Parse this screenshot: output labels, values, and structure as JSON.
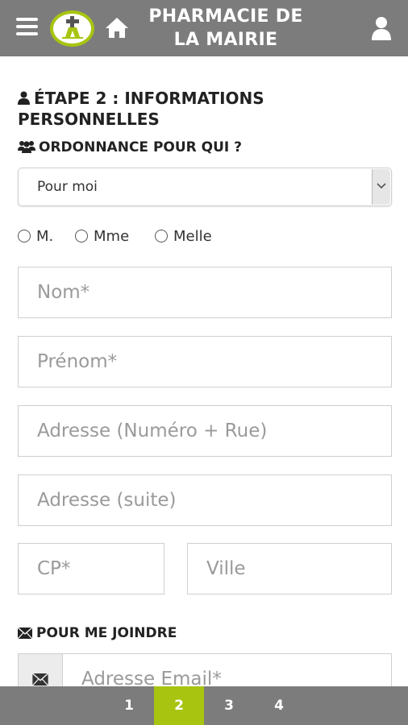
{
  "header": {
    "title": "PHARMACIE DE LA MAIRIE",
    "menu_icon": "hamburger-menu-icon",
    "home_icon": "home-icon",
    "user_icon": "user-icon",
    "bar_color": "#7c7c7c",
    "accent_color": "#a8c410"
  },
  "step": {
    "title": "ÉTAPE 2 : INFORMATIONS PERSONNELLES",
    "icon": "user-icon"
  },
  "prescription": {
    "label": "ORDONNANCE POUR QUI ?",
    "icon": "users-icon",
    "selected": "Pour moi"
  },
  "civility": {
    "options": [
      "M.",
      "Mme",
      "Melle"
    ]
  },
  "form": {
    "nom_placeholder": "Nom*",
    "prenom_placeholder": "Prénom*",
    "adresse_placeholder": "Adresse (Numéro + Rue)",
    "adresse_suite_placeholder": "Adresse (suite)",
    "cp_placeholder": "CP*",
    "ville_placeholder": "Ville"
  },
  "contact": {
    "label": "POUR ME JOINDRE",
    "icon": "envelope-icon",
    "email_placeholder": "Adresse Email*"
  },
  "pager": {
    "pages": [
      "1",
      "2",
      "3",
      "4"
    ],
    "active": "2"
  }
}
